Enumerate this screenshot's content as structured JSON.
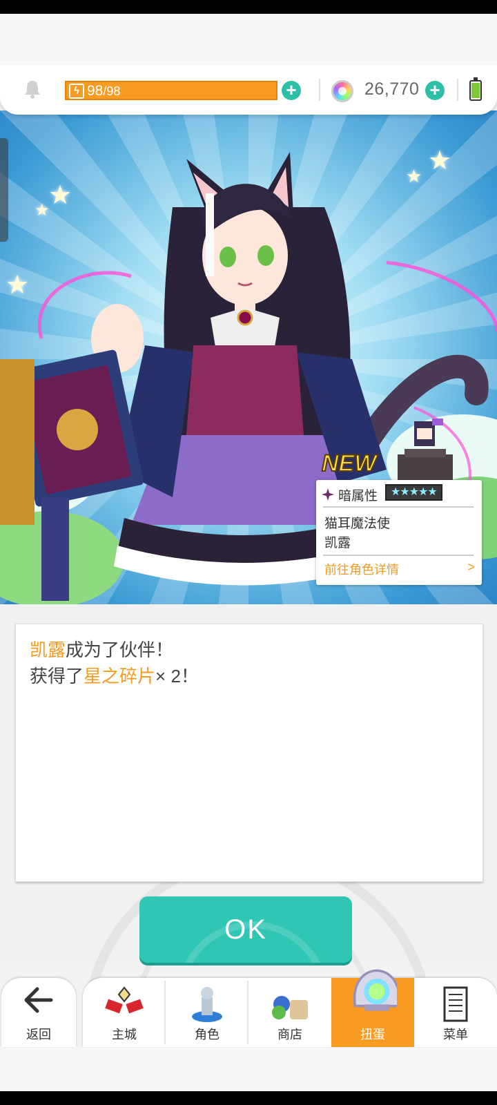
{
  "status_bar": {
    "stamina_current": "98",
    "stamina_max": "/98",
    "gems": "26,770"
  },
  "hero": {
    "new_badge": "NEW",
    "card": {
      "attribute": "暗属性",
      "rarity_stars": "★★★★★",
      "title": "猫耳魔法使",
      "name": "凯露",
      "link_label": "前往角色详情",
      "link_arrow": ">"
    }
  },
  "message": {
    "line1_name": "凯露",
    "line1_rest": "成为了伙伴！",
    "line2_prefix": "获得了",
    "line2_item": "星之碎片",
    "line2_suffix": "× 2！"
  },
  "ok_label": "OK",
  "nav": {
    "back": "返回",
    "items": [
      {
        "label": "主城"
      },
      {
        "label": "角色"
      },
      {
        "label": "商店"
      },
      {
        "label": "扭蛋"
      },
      {
        "label": "菜单"
      }
    ]
  },
  "colors": {
    "accent_orange": "#f79b22",
    "ok_teal": "#2fc6b4",
    "highlight_text": "#f39a21"
  }
}
